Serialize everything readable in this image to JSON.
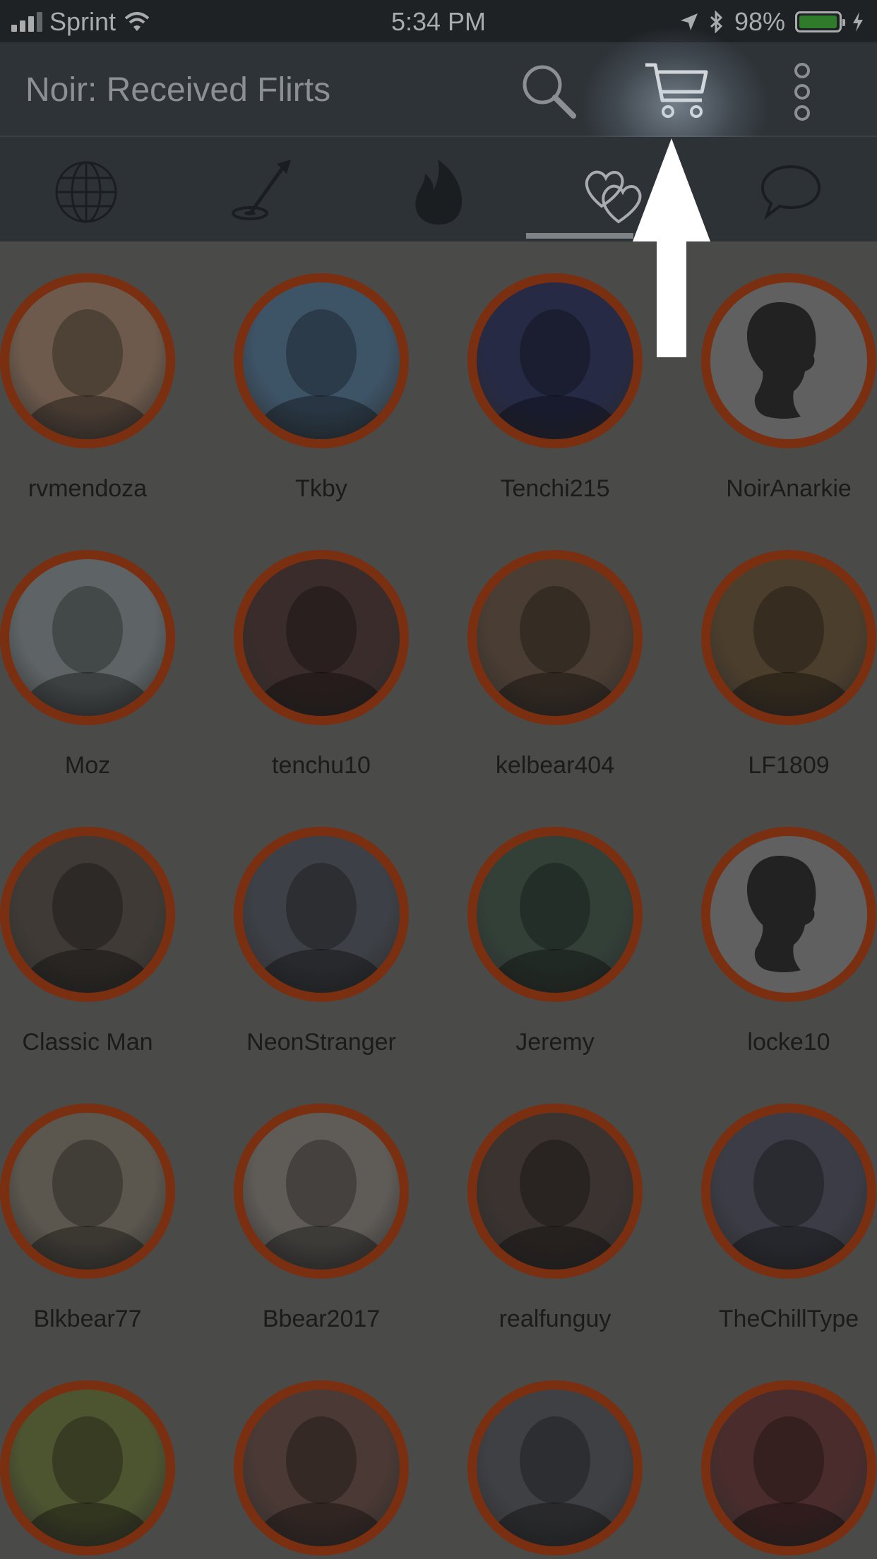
{
  "status_bar": {
    "carrier": "Sprint",
    "time": "5:34 PM",
    "battery": "98%",
    "battery_level": 0.98
  },
  "header": {
    "title": "Noir: Received Flirts",
    "icons": [
      "search-icon",
      "cart-icon",
      "more-vert-icon"
    ]
  },
  "tabs": [
    {
      "name": "globe-icon",
      "selected": false
    },
    {
      "name": "target-dart-icon",
      "selected": false
    },
    {
      "name": "fire-icon",
      "selected": false
    },
    {
      "name": "hearts-icon",
      "selected": true
    },
    {
      "name": "chat-bubble-icon",
      "selected": false
    }
  ],
  "colors": {
    "overlay": "#4a4a48",
    "avatar_ring": "#7a2f10",
    "header_bg": "#2e3338"
  },
  "users": [
    {
      "name": "rvmendoza",
      "photo": "#6d5a4c"
    },
    {
      "name": "Tkby",
      "photo": "#3d5366"
    },
    {
      "name": "Tenchi215",
      "photo": "#262a45"
    },
    {
      "name": "NoirAnarkie",
      "photo": "silhouette"
    },
    {
      "name": "Moz",
      "photo": "#5e6466"
    },
    {
      "name": "tenchu10",
      "photo": "#3a2c2a"
    },
    {
      "name": "kelbear404",
      "photo": "#4a3d33"
    },
    {
      "name": "LF1809",
      "photo": "#4c3e2c"
    },
    {
      "name": "Classic Man",
      "photo": "#3f3a35"
    },
    {
      "name": "NeonStranger",
      "photo": "#3d4046"
    },
    {
      "name": "Jeremy",
      "photo": "#334038"
    },
    {
      "name": "locke10",
      "photo": "silhouette"
    },
    {
      "name": "Blkbear77",
      "photo": "#5b564e"
    },
    {
      "name": "Bbear2017",
      "photo": "#5f5b57"
    },
    {
      "name": "realfunguy",
      "photo": "#3a3330"
    },
    {
      "name": "TheChillType",
      "photo": "#3b3c45"
    },
    {
      "name": "",
      "photo": "#4d5430"
    },
    {
      "name": "",
      "photo": "#4a3934"
    },
    {
      "name": "",
      "photo": "#3f4044"
    },
    {
      "name": "",
      "photo": "#4a2c2c"
    }
  ]
}
